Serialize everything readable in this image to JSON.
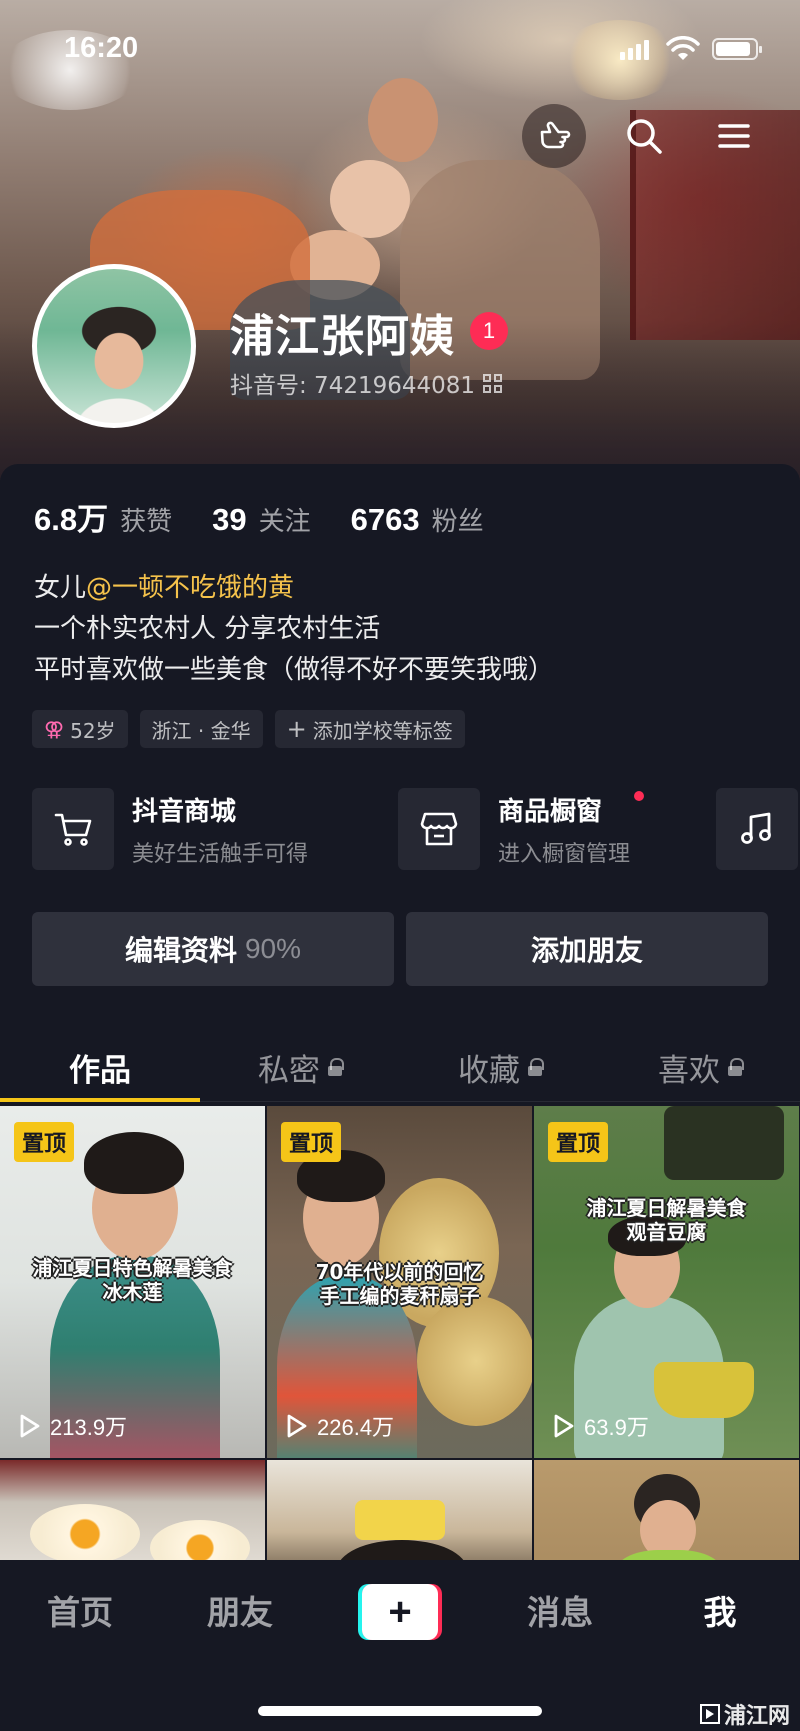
{
  "status_bar": {
    "time": "16:20"
  },
  "profile": {
    "name": "浦江张阿姨",
    "badge_count": "1",
    "douyin_id": "抖音号: 74219644081"
  },
  "stats": [
    {
      "value": "6.8万",
      "label": "获赞"
    },
    {
      "value": "39",
      "label": "关注"
    },
    {
      "value": "6763",
      "label": "粉丝"
    }
  ],
  "bio": {
    "prefix": "女儿",
    "mention": "@一顿不吃饿的黄",
    "line2": "一个朴实农村人 分享农村生活",
    "line3": "平时喜欢做一些美食（做得不好不要笑我哦）"
  },
  "tags": {
    "age": "52岁",
    "location": "浙江 · 金华",
    "add": "添加学校等标签"
  },
  "shops": [
    {
      "title": "抖音商城",
      "subtitle": "美好生活触手可得"
    },
    {
      "title": "商品橱窗",
      "subtitle": "进入橱窗管理"
    }
  ],
  "buttons": {
    "edit_label": "编辑资料",
    "edit_percent": "90%",
    "add_friend": "添加朋友"
  },
  "tabs": [
    {
      "label": "作品",
      "locked": false
    },
    {
      "label": "私密",
      "locked": true
    },
    {
      "label": "收藏",
      "locked": true
    },
    {
      "label": "喜欢",
      "locked": true
    }
  ],
  "videos": [
    {
      "pinned": "置顶",
      "caption_line1": "浦江夏日特色解暑美食",
      "caption_line2": "冰木莲",
      "plays": "213.9万"
    },
    {
      "pinned": "置顶",
      "caption_line1": "70年代以前的回忆",
      "caption_line2": "手工编的麦秆扇子",
      "plays": "226.4万"
    },
    {
      "pinned": "置顶",
      "caption_line1": "浦江夏日解暑美食",
      "caption_line2": "观音豆腐",
      "plays": "63.9万"
    }
  ],
  "bottom_nav": [
    {
      "label": "首页"
    },
    {
      "label": "朋友"
    },
    {
      "label": "消息"
    },
    {
      "label": "我"
    }
  ],
  "watermark": "浦江网",
  "colors": {
    "background": "#161823",
    "accent_yellow": "#f5c518",
    "brand_red": "#fe2c55",
    "brand_cyan": "#25f4ee",
    "mention": "#f5c24b"
  },
  "icons": [
    "pointing-hand-icon",
    "search-icon",
    "menu-icon",
    "qr-code-icon",
    "female-icon",
    "plus-icon",
    "cart-icon",
    "storefront-icon",
    "music-note-icon",
    "lock-icon",
    "play-icon"
  ]
}
